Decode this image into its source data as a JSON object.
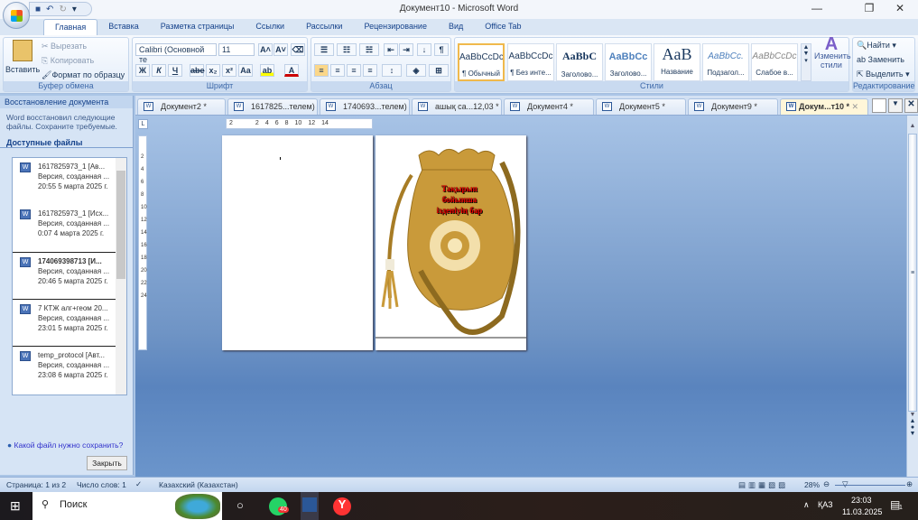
{
  "window": {
    "title": "Документ10 - Microsoft Word",
    "minimize": "—",
    "restore": "❐",
    "close": "✕"
  },
  "ribbon_tabs": [
    "Главная",
    "Вставка",
    "Разметка страницы",
    "Ссылки",
    "Рассылки",
    "Рецензирование",
    "Вид",
    "Office Tab"
  ],
  "clipboard": {
    "paste": "Вставить",
    "cut": "Вырезать",
    "copy": "Копировать",
    "format_painter": "Формат по образцу",
    "label": "Буфер обмена"
  },
  "font": {
    "name": "Calibri (Основной те",
    "size": "11",
    "bold": "Ж",
    "italic": "К",
    "underline": "Ч",
    "strike": "abe",
    "sub": "x₂",
    "sup": "x²",
    "case": "Aa",
    "label": "Шрифт"
  },
  "paragraph": {
    "label": "Абзац"
  },
  "styles": {
    "items": [
      {
        "sample": "AaBbCcDc",
        "name": "¶ Обычный"
      },
      {
        "sample": "AaBbCcDc",
        "name": "¶ Без инте..."
      },
      {
        "sample": "AaBbC",
        "name": "Заголово..."
      },
      {
        "sample": "AaBbCc",
        "name": "Заголово..."
      },
      {
        "sample": "AaB",
        "name": "Название"
      },
      {
        "sample": "AaBbCc.",
        "name": "Подзагол..."
      },
      {
        "sample": "AaBbCcDc",
        "name": "Слабое в..."
      }
    ],
    "change": "Изменить стили",
    "label": "Стили"
  },
  "editing": {
    "find": "Найти",
    "replace": "Заменить",
    "select": "Выделить",
    "label": "Редактирование"
  },
  "recovery": {
    "title": "Восстановление документа",
    "message": "Word восстановил следующие файлы.  Сохраните требуемые.",
    "available": "Доступные файлы",
    "files": [
      {
        "name": "1617825973_1  [Ав...",
        "desc": "Версия, созданная ...",
        "time": "20:55 5 марта 2025 г."
      },
      {
        "name": "1617825973_1  [Исх...",
        "desc": "Версия, созданная ...",
        "time": "0:07 4 марта 2025 г."
      },
      {
        "name": "174069398713  [И...",
        "desc": "Версия, созданная ...",
        "time": "20:46 5 марта 2025 г."
      },
      {
        "name": "7 КТЖ алг+геом 20...",
        "desc": "Версия, созданная ...",
        "time": "23:01 5 марта 2025 г."
      },
      {
        "name": "temp_protocol  [Авт...",
        "desc": "Версия, созданная ...",
        "time": "23:08 6 марта 2025 г."
      }
    ],
    "help": "Какой файл нужно сохранить?",
    "close": "Закрыть"
  },
  "doc_tabs": [
    "Документ2 *",
    "1617825...телем)",
    "1740693...телем)",
    "ашық са...12,03 *",
    "Документ4 *",
    "Документ5 *",
    "Документ9 *",
    "Докум...т10 *"
  ],
  "ruler_h": [
    "2",
    "2",
    "4",
    "6",
    "8",
    "10",
    "12",
    "14"
  ],
  "ruler_v": [
    "2",
    "4",
    "6",
    "8",
    "10",
    "12",
    "14",
    "16",
    "18",
    "20",
    "22",
    "24"
  ],
  "page2_text": [
    "Тақырып",
    "бойынша",
    "ізденіуің бар"
  ],
  "status": {
    "page": "Страница: 1 из 2",
    "words": "Число слов: 1",
    "language": "Казахский (Казахстан)",
    "zoom": "28%"
  },
  "taskbar": {
    "search": "Поиск",
    "whatsapp_badge": "40",
    "lang": "ҚАЗ",
    "time": "23:03",
    "date": "11.03.2025",
    "notif": "1"
  }
}
